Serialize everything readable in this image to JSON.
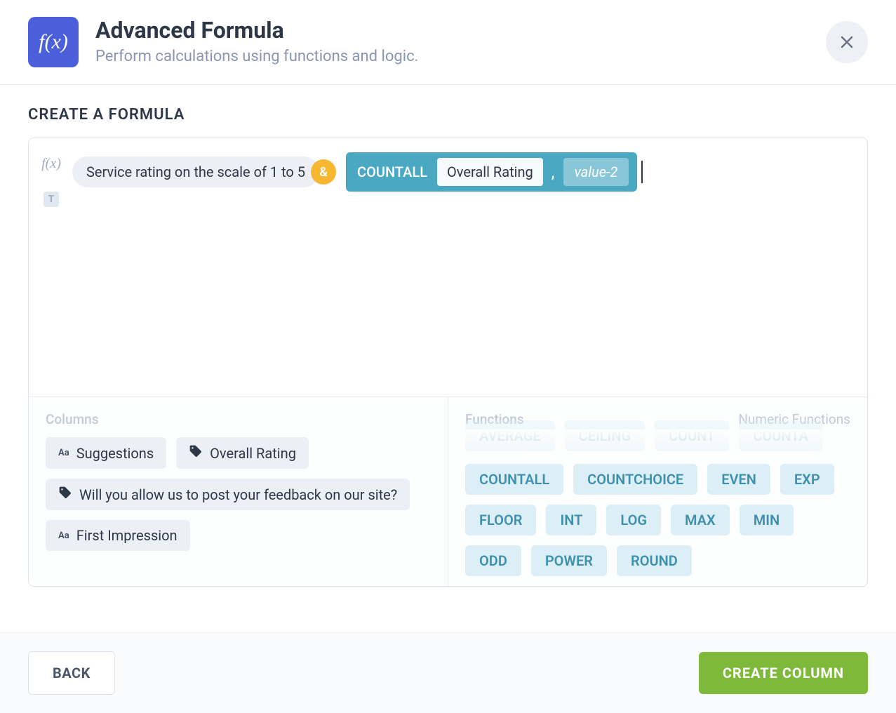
{
  "header": {
    "title": "Advanced Formula",
    "subtitle": "Perform calculations using functions and logic.",
    "icon": "f(x)"
  },
  "sectionTitle": "CREATE A FORMULA",
  "sideIcons": {
    "fx": "f(x)",
    "text": "T"
  },
  "formula": {
    "textToken": "Service rating on the scale of 1 to 5",
    "operator": "&",
    "func": {
      "name": "COUNTALL",
      "arg1": "Overall Rating",
      "comma": ",",
      "placeholder": "value-2"
    }
  },
  "panes": {
    "columns": {
      "title": "Columns",
      "items": [
        {
          "icon": "aa",
          "label": "Suggestions"
        },
        {
          "icon": "tag",
          "label": "Overall Rating"
        },
        {
          "icon": "tag",
          "label": "Will you allow us to post your feedback on our site?"
        },
        {
          "icon": "aa",
          "label": "First Impression"
        }
      ]
    },
    "functions": {
      "title": "Functions",
      "category": "Numeric Functions",
      "partial": [
        "AVERAGE",
        "CEILING",
        "COUNT",
        "COUNTA"
      ],
      "items": [
        "COUNTALL",
        "COUNTCHOICE",
        "EVEN",
        "EXP",
        "FLOOR",
        "INT",
        "LOG",
        "MAX",
        "MIN",
        "ODD",
        "POWER",
        "ROUND"
      ]
    }
  },
  "footer": {
    "back": "BACK",
    "create": "CREATE COLUMN"
  }
}
